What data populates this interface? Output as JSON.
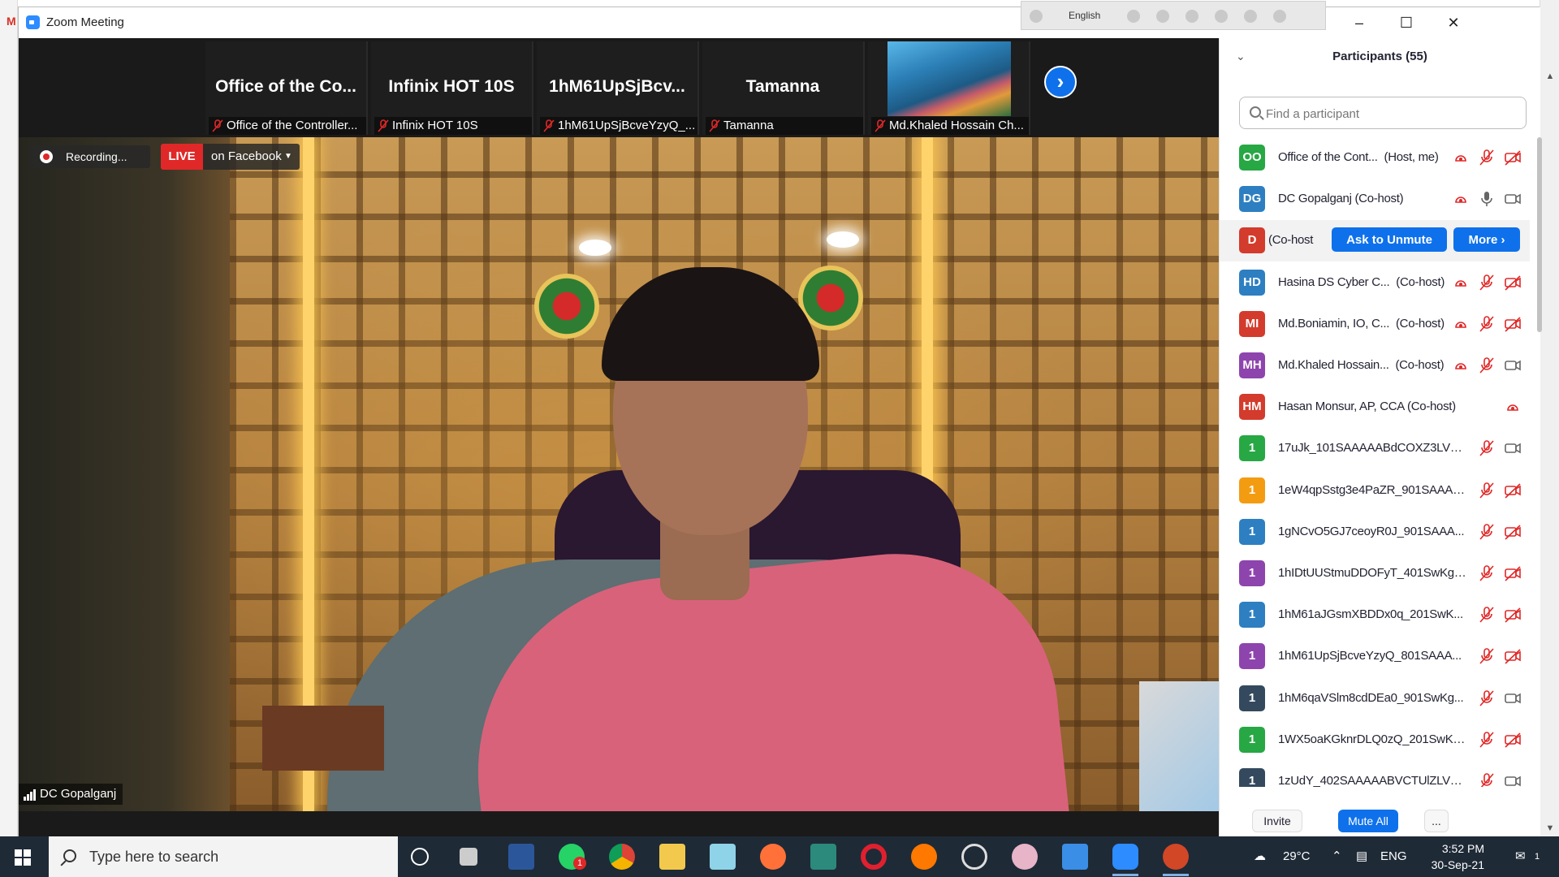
{
  "window": {
    "title": "Zoom Meeting",
    "lang_indicator": "English"
  },
  "thumbnails": [
    {
      "name": "Office of the Co...",
      "label": "Office of the Controller..."
    },
    {
      "name": "Infinix HOT 10S",
      "label": "Infinix HOT 10S"
    },
    {
      "name": "1hM61UpSjBcv...",
      "label": "1hM61UpSjBcveYzyQ_..."
    },
    {
      "name": "Tamanna",
      "label": "Tamanna"
    },
    {
      "name": "",
      "label": "Md.Khaled Hossain Ch..."
    }
  ],
  "main_video": {
    "recording_label": "Recording...",
    "live_tag": "LIVE",
    "live_destination": "on Facebook",
    "speaker_name": "DC Gopalganj"
  },
  "participants_panel": {
    "title": "Participants (55)",
    "search_placeholder": "Find a participant",
    "participants": [
      {
        "initials": "OO",
        "color": "#27a844",
        "name": "Office of the Cont...",
        "role": "(Host, me)",
        "rec": true,
        "mic": "muted",
        "cam": "off"
      },
      {
        "initials": "DG",
        "color": "#2d7fc1",
        "name": "DC Gopalganj (Co-host)",
        "role": "",
        "rec": true,
        "mic": "on",
        "cam": "on"
      },
      {
        "initials": "D",
        "color": "#d33b2c",
        "name": "(Co-host",
        "role": "",
        "rec": false,
        "mic": "none",
        "cam": "none",
        "hover": true
      },
      {
        "initials": "HD",
        "color": "#2d7fc1",
        "name": "Hasina DS Cyber C...",
        "role": "(Co-host)",
        "rec": true,
        "mic": "muted",
        "cam": "off"
      },
      {
        "initials": "MI",
        "color": "#d33b2c",
        "name": "Md.Boniamin, IO, C...",
        "role": "(Co-host)",
        "rec": true,
        "mic": "muted",
        "cam": "off"
      },
      {
        "initials": "MH",
        "color": "#8e44ad",
        "name": "Md.Khaled Hossain...",
        "role": "(Co-host)",
        "rec": true,
        "mic": "muted",
        "cam": "on"
      },
      {
        "initials": "HM",
        "color": "#d33b2c",
        "name": "Hasan Monsur, AP, CCA (Co-host)",
        "role": "",
        "rec": false,
        "rec_right": true,
        "mic": "none",
        "cam": "none"
      },
      {
        "initials": "1",
        "color": "#27a844",
        "name": "17uJk_101SAAAAABdCOXZ3LVN...",
        "role": "",
        "rec": false,
        "mic": "muted",
        "cam": "on"
      },
      {
        "initials": "1",
        "color": "#f39c12",
        "name": "1eW4qpSstg3e4PaZR_901SAAAA...",
        "role": "",
        "rec": false,
        "mic": "muted",
        "cam": "off"
      },
      {
        "initials": "1",
        "color": "#2d7fc1",
        "name": "1gNCvO5GJ7ceoyR0J_901SAAA...",
        "role": "",
        "rec": false,
        "mic": "muted",
        "cam": "off"
      },
      {
        "initials": "1",
        "color": "#8e44ad",
        "name": "1hIDtUUStmuDDOFyT_401SwKgr...",
        "role": "",
        "rec": false,
        "mic": "muted",
        "cam": "off"
      },
      {
        "initials": "1",
        "color": "#2d7fc1",
        "name": "1hM61aJGsmXBDDx0q_201SwK...",
        "role": "",
        "rec": false,
        "mic": "muted",
        "cam": "off"
      },
      {
        "initials": "1",
        "color": "#8e44ad",
        "name": "1hM61UpSjBcveYzyQ_801SAAA...",
        "role": "",
        "rec": false,
        "mic": "muted",
        "cam": "off"
      },
      {
        "initials": "1",
        "color": "#34495e",
        "name": "1hM6qaVSlm8cdDEa0_901SwKg...",
        "role": "",
        "rec": false,
        "mic": "muted",
        "cam": "on"
      },
      {
        "initials": "1",
        "color": "#27a844",
        "name": "1WX5oaKGknrDLQ0zQ_201SwKg...",
        "role": "",
        "rec": false,
        "mic": "muted",
        "cam": "off"
      },
      {
        "initials": "1",
        "color": "#34495e",
        "name": "1zUdY_402SAAAAABVCTUlZLVds...",
        "role": "",
        "rec": false,
        "mic": "muted",
        "cam": "on"
      }
    ],
    "hover_actions": {
      "ask_unmute": "Ask to Unmute",
      "more": "More"
    },
    "footer": {
      "invite": "Invite",
      "mute_all": "Mute All",
      "more": "..."
    }
  },
  "taskbar": {
    "search_placeholder": "Type here to search",
    "apps": [
      "cortana-icon",
      "task-view-icon",
      "word-icon",
      "whatsapp-icon",
      "chrome-icon",
      "file-explorer-icon",
      "notes-icon",
      "firefox-icon",
      "camtasia-icon",
      "opera-icon",
      "avast-icon",
      "obs-icon",
      "paint-icon",
      "photos-icon",
      "zoom-icon",
      "powerpoint-icon"
    ],
    "whatsapp_badge": "1",
    "weather": "29°C",
    "language": "ENG",
    "time": "3:52 PM",
    "date": "30-Sep-21",
    "notifications": "1"
  },
  "colors": {
    "zoom_blue": "#0e71eb",
    "live_red": "#e02828",
    "muted_red": "#e02828"
  }
}
